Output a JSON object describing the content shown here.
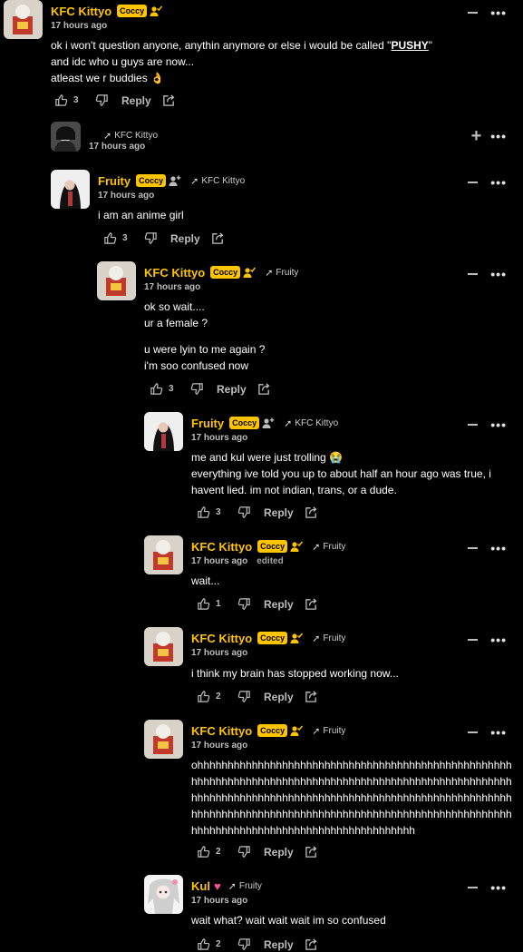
{
  "comments": [
    {
      "author": "KFC Kittyo",
      "badge": "Coccy",
      "time": "17 hours ago",
      "lines": [
        [
          "ok i won't question anyone, anythin anymore or else i would be called \"",
          "PUSHY",
          "\""
        ],
        "and idc who u guys are now...",
        "atleast we r buddies 👌"
      ],
      "likes": "3",
      "reply_label": "Reply"
    },
    {
      "reply_to": "KFC Kittyo",
      "time": "17 hours ago",
      "collapsed": true
    },
    {
      "author": "Fruity",
      "badge": "Coccy",
      "reply_to": "KFC Kittyo",
      "time": "17 hours ago",
      "lines": [
        "i am an anime girl"
      ],
      "likes": "3",
      "reply_label": "Reply"
    },
    {
      "author": "KFC Kittyo",
      "badge": "Coccy",
      "reply_to": "Fruity",
      "time": "17 hours ago",
      "lines": [
        "ok so wait....",
        "ur a female ?",
        "",
        "u were lyin to me again ?",
        "i'm soo confused now"
      ],
      "likes": "3",
      "reply_label": "Reply"
    },
    {
      "author": "Fruity",
      "badge": "Coccy",
      "reply_to": "KFC Kittyo",
      "time": "17 hours ago",
      "lines": [
        "me and kul were just trolling 😭",
        "everything ive told you up to about half an hour ago was true, i havent lied. im not indian, trans, or a dude."
      ],
      "likes": "3",
      "reply_label": "Reply"
    },
    {
      "author": "KFC Kittyo",
      "badge": "Coccy",
      "reply_to": "Fruity",
      "time": "17 hours ago",
      "edited": "edited",
      "lines": [
        "wait..."
      ],
      "likes": "1",
      "reply_label": "Reply"
    },
    {
      "author": "KFC Kittyo",
      "badge": "Coccy",
      "reply_to": "Fruity",
      "time": "17 hours ago",
      "lines": [
        "i think my brain has stopped working now..."
      ],
      "likes": "2",
      "reply_label": "Reply"
    },
    {
      "author": "KFC Kittyo",
      "badge": "Coccy",
      "reply_to": "Fruity",
      "time": "17 hours ago",
      "lines": [
        "ohhhhhhhhhhhhhhhhhhhhhhhhhhhhhhhhhhhhhhhhhhhhhhhhhhhhhhhhhhhhhhhhhhhhhhhhhhhhhhhhhhhhhhhhhhhhhhhhhhhhhhhhhhhhhhhhhhhhhhhhhhhhhhhhhhhhhhhhhhhhhhhhhhhhhhhhhhhhhhhhhhhhhhhhhhhhhhhhhhhhhhhhhhhhhhhhhhhhhhhhhhhhhhhhhhhhhhhhhhhhhhhhhhhhhhhhhhhhhhhhhhhhhhhh"
      ],
      "likes": "2",
      "reply_label": "Reply"
    },
    {
      "author": "Kul",
      "reply_to": "Fruity",
      "time": "17 hours ago",
      "lines": [
        "wait what? wait wait wait im so confused"
      ],
      "likes": "2",
      "reply_label": "Reply"
    }
  ]
}
